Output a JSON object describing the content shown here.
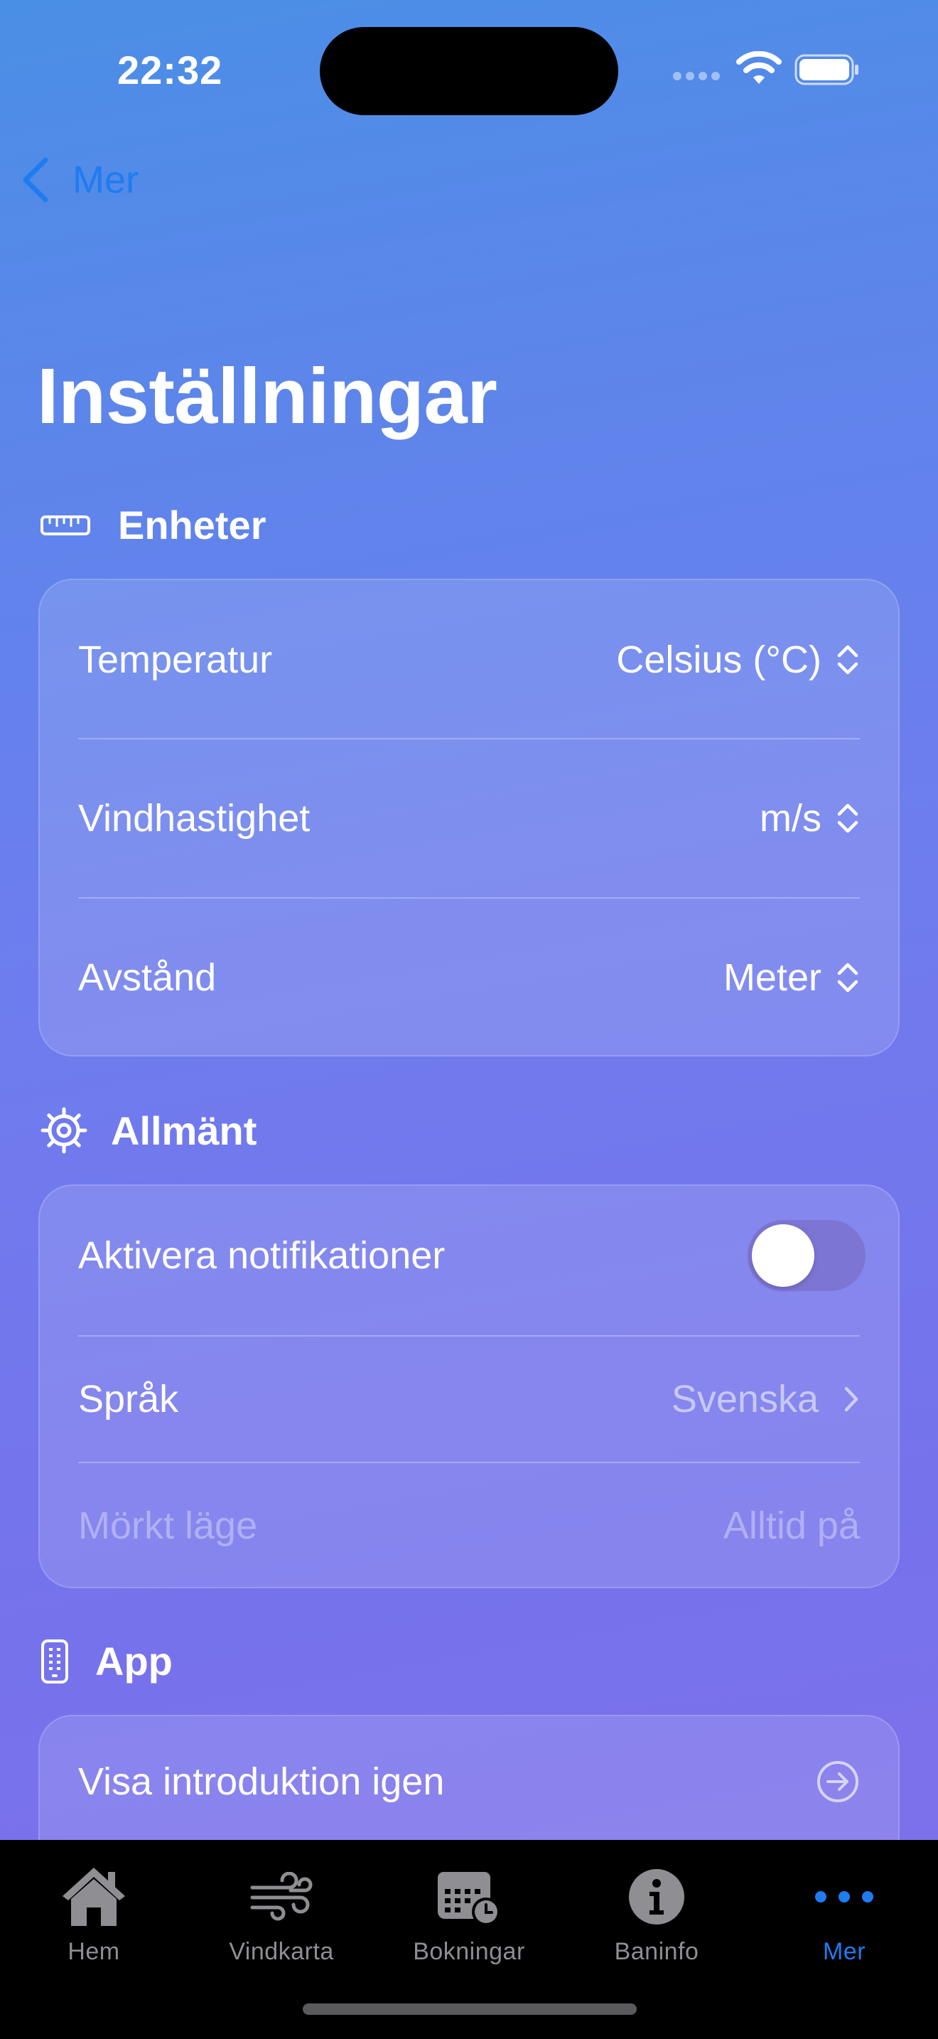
{
  "status": {
    "time": "22:32"
  },
  "nav": {
    "back_label": "Mer"
  },
  "page": {
    "title": "Inställningar"
  },
  "sections": {
    "units": {
      "title": "Enheter",
      "rows": [
        {
          "label": "Temperatur",
          "value": "Celsius (°C)"
        },
        {
          "label": "Vindhastighet",
          "value": "m/s"
        },
        {
          "label": "Avstånd",
          "value": "Meter"
        }
      ]
    },
    "general": {
      "title": "Allmänt",
      "notifications": {
        "label": "Aktivera notifikationer",
        "enabled": false
      },
      "language": {
        "label": "Språk",
        "value": "Svenska"
      },
      "dark_mode": {
        "label": "Mörkt läge",
        "value": "Alltid på"
      }
    },
    "app": {
      "title": "App",
      "intro": {
        "label": "Visa introduktion igen"
      }
    }
  },
  "tabs": [
    {
      "label": "Hem",
      "icon": "house-icon",
      "active": false
    },
    {
      "label": "Vindkarta",
      "icon": "wind-icon",
      "active": false
    },
    {
      "label": "Bokningar",
      "icon": "calendar-clock-icon",
      "active": false
    },
    {
      "label": "Baninfo",
      "icon": "info-icon",
      "active": false
    },
    {
      "label": "Mer",
      "icon": "more-icon",
      "active": true
    }
  ],
  "colors": {
    "accent": "#1f7cf0",
    "tab_inactive": "#8e8e93",
    "tab_bar": "#000000"
  }
}
